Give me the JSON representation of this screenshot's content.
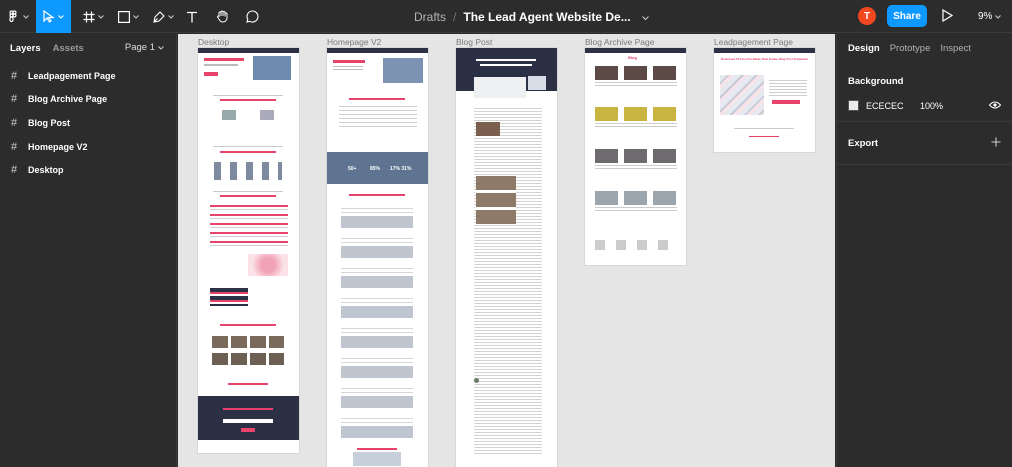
{
  "toolbar": {
    "main_menu_icon": "figma-logo-icon",
    "tools": [
      {
        "name": "move-tool",
        "active": true
      },
      {
        "name": "frame-tool",
        "active": false
      },
      {
        "name": "shape-tool",
        "active": false
      },
      {
        "name": "pen-tool",
        "active": false
      },
      {
        "name": "text-tool",
        "active": false
      },
      {
        "name": "hand-tool",
        "active": false
      },
      {
        "name": "comment-tool",
        "active": false
      }
    ],
    "breadcrumb": {
      "project": "Drafts",
      "separator": "/",
      "file": "The Lead Agent Website De..."
    },
    "avatar_initial": "T",
    "share_label": "Share",
    "zoom": "9%",
    "accent_color": "#0d99ff"
  },
  "left_panel": {
    "tabs": [
      "Layers",
      "Assets"
    ],
    "page_selector": "Page 1",
    "layers": [
      "Leadpagement Page",
      "Blog Archive Page",
      "Blog Post",
      "Homepage V2",
      "Desktop"
    ]
  },
  "canvas": {
    "background": "#e5e5e5",
    "frames": [
      {
        "label": "Desktop"
      },
      {
        "label": "Homepage V2"
      },
      {
        "label": "Blog Post"
      },
      {
        "label": "Blog Archive Page"
      },
      {
        "label": "Leadpagement Page"
      }
    ],
    "desktop": {
      "stat_labels": [
        "50+",
        "85%",
        "17% 31%"
      ]
    },
    "leadpage": {
      "headline": "Download 50 Free Pre-Made Real Estate Blog Post Templates"
    },
    "blog_archive": {
      "title": "Blog"
    }
  },
  "right_panel": {
    "tabs": [
      "Design",
      "Prototype",
      "Inspect"
    ],
    "background": {
      "title": "Background",
      "hex": "ECECEC",
      "opacity": "100%"
    },
    "export": {
      "title": "Export"
    }
  }
}
